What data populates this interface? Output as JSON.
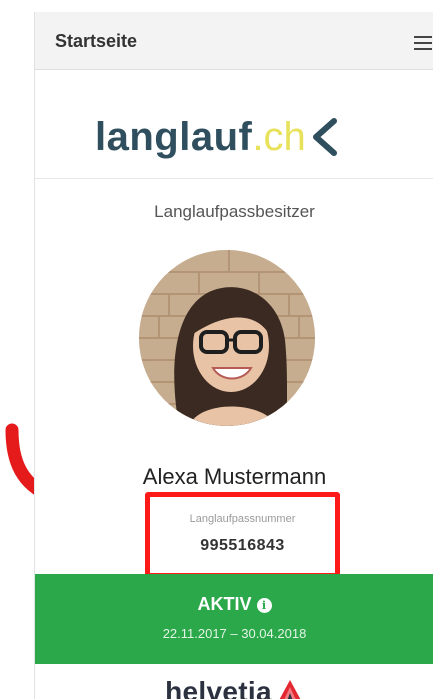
{
  "header": {
    "title": "Startseite",
    "menu_icon": "hamburger-menu-icon"
  },
  "logo": {
    "main": "langlauf",
    "dot": ".",
    "tld": "ch",
    "chevron_icon": "chevron-left-icon",
    "colors": {
      "main": "#2f4f5f",
      "accent": "#e8e15a",
      "chevron": "#2f4f5f"
    }
  },
  "owner": {
    "label": "Langlaufpassbesitzer",
    "name": "Alexa Mustermann",
    "avatar_icon": "person-avatar-photo"
  },
  "pass": {
    "label": "Langlaufpassnummer",
    "number": "995516843",
    "highlight_color": "#ff1a1a"
  },
  "status": {
    "text": "AKTIV",
    "info_icon": "info-icon",
    "info_glyph": "i",
    "range": "22.11.2017 – 30.04.2018",
    "color": "#2aa84a"
  },
  "sponsor": {
    "name": "helvetia",
    "mark_icon": "helvetia-logo-mark",
    "colors": {
      "text": "#2c3140",
      "mark": "#e3262f"
    }
  },
  "annotation": {
    "arrow_icon": "red-curved-arrow-icon",
    "color": "#e51a1a"
  }
}
